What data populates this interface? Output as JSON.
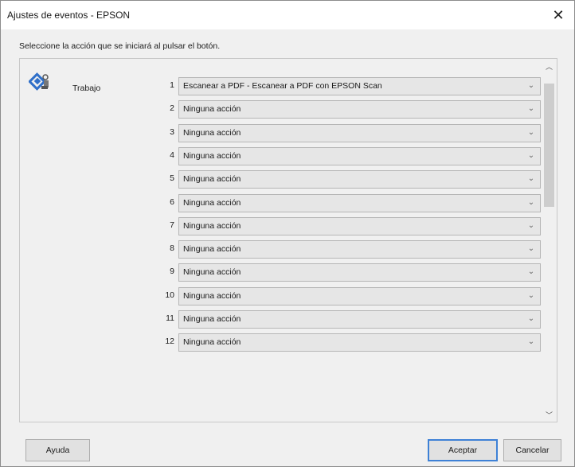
{
  "window": {
    "title": "Ajustes de eventos - EPSON",
    "close_symbol": "✕"
  },
  "instruction": "Seleccione la acción que se iniciará al pulsar el botón.",
  "left": {
    "icon": "scanner-job-icon",
    "label": "Trabajo"
  },
  "rows": [
    {
      "num": "1",
      "value": "Escanear a PDF - Escanear a PDF con EPSON Scan"
    },
    {
      "num": "2",
      "value": "Ninguna acción"
    },
    {
      "num": "3",
      "value": "Ninguna acción"
    },
    {
      "num": "4",
      "value": "Ninguna acción"
    },
    {
      "num": "5",
      "value": "Ninguna acción"
    },
    {
      "num": "6",
      "value": "Ninguna acción"
    },
    {
      "num": "7",
      "value": "Ninguna acción"
    },
    {
      "num": "8",
      "value": "Ninguna acción"
    },
    {
      "num": "9",
      "value": "Ninguna acción"
    },
    {
      "num": "10",
      "value": "Ninguna acción"
    },
    {
      "num": "11",
      "value": "Ninguna acción"
    },
    {
      "num": "12",
      "value": "Ninguna acción"
    }
  ],
  "buttons": {
    "help": "Ayuda",
    "ok": "Aceptar",
    "cancel": "Cancelar"
  },
  "colors": {
    "dialog_bg": "#f0f0f0",
    "select_bg": "#e6e6e6",
    "focus_border": "#3e81d6",
    "icon_blue": "#2f6fc9"
  }
}
